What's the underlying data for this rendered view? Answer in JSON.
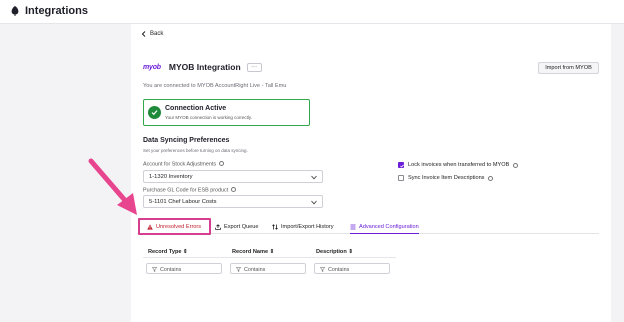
{
  "header": {
    "title": "Integrations",
    "icon": "leaf-icon"
  },
  "nav": {
    "back_label": "Back"
  },
  "integration": {
    "logo_text": "myob",
    "title": "MYOB Integration",
    "more_label": "···",
    "import_label": "Import from MYOB",
    "connected_text": "You are connected to MYOB AccountRight Live - Tall Emu"
  },
  "connection": {
    "status": "Connection Active",
    "detail": "Your MYOB connection is working correctly.",
    "color": "#1f8a3a"
  },
  "sync": {
    "title": "Data Syncing Preferences",
    "subtitle": "Set your preferences before turning on data syncing.",
    "stock_label": "Account for Stock Adjustments",
    "stock_value": "1-1320 Inventory",
    "gl_label": "Purchase GL Code for ESB product",
    "gl_value": "5-1101 Chef Labour Costs",
    "lock_label": "Lock invoices when transferred to MYOB",
    "lock_checked": true,
    "sync_desc_label": "Sync Invoice Item Descriptions",
    "sync_desc_checked": false
  },
  "tabs": [
    {
      "label": "Unresolved Errors",
      "icon": "warning-icon"
    },
    {
      "label": "Export Queue",
      "icon": "upload-icon"
    },
    {
      "label": "Import/Export History",
      "icon": "swap-icon"
    },
    {
      "label": "Advanced Configuration",
      "icon": "list-icon"
    }
  ],
  "table": {
    "columns": [
      "Record Type ⇕",
      "Record Name ⇕",
      "Description ⇕"
    ],
    "filter_placeholder": "Contains"
  },
  "colors": {
    "accent": "#6a1cd6",
    "error": "#c0202d",
    "highlight": "#d63e8f"
  }
}
